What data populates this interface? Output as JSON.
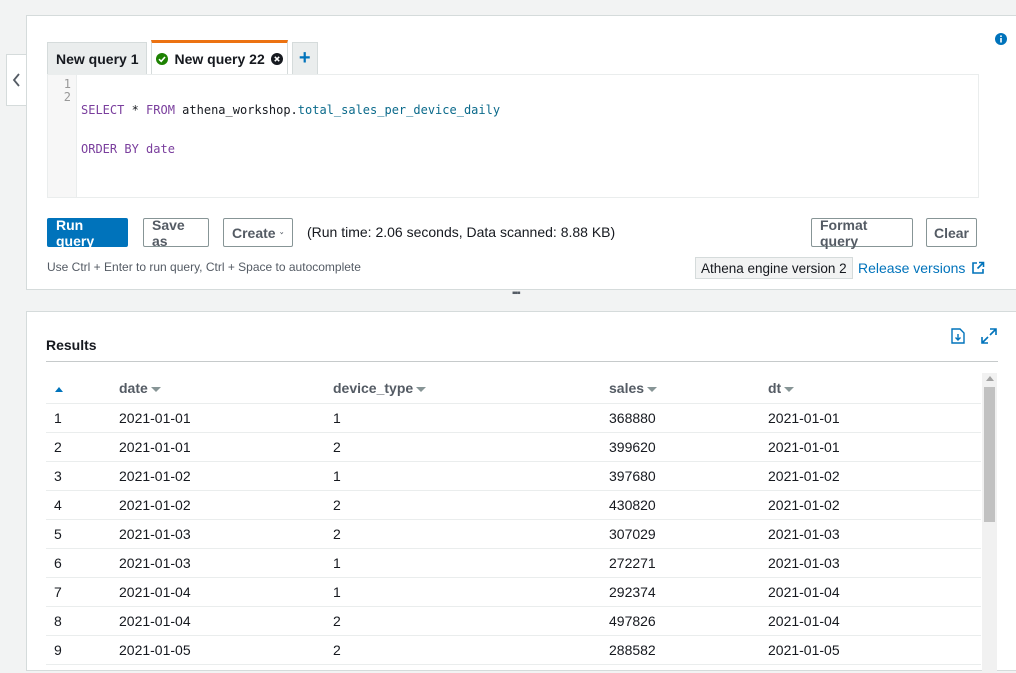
{
  "editor": {
    "tabs": [
      {
        "label": "New query 1",
        "active": false
      },
      {
        "label": "New query 22",
        "active": true,
        "status": "succeeded"
      }
    ],
    "add_tab_label": "+",
    "lines": [
      {
        "num": "1",
        "tokens": [
          {
            "text": "SELECT",
            "cls": "kw"
          },
          {
            "text": " * ",
            "cls": "id"
          },
          {
            "text": "FROM",
            "cls": "kw"
          },
          {
            "text": " athena_workshop.",
            "cls": "id"
          },
          {
            "text": "total_sales_per_device_daily",
            "cls": "tbl"
          }
        ]
      },
      {
        "num": "2",
        "tokens": [
          {
            "text": "ORDER BY",
            "cls": "kw"
          },
          {
            "text": " ",
            "cls": "id"
          },
          {
            "text": "date",
            "cls": "kw"
          }
        ]
      }
    ]
  },
  "toolbar": {
    "run_label": "Run query",
    "save_label": "Save as",
    "create_label": "Create",
    "run_info": "(Run time: 2.06 seconds, Data scanned: 8.88 KB)",
    "format_label": "Format query",
    "clear_label": "Clear"
  },
  "hint": "Use Ctrl + Enter to run query, Ctrl + Space to autocomplete",
  "engine_version": "Athena engine version 2",
  "release_versions": "Release versions",
  "results": {
    "title": "Results",
    "columns": [
      "date",
      "device_type",
      "sales",
      "dt"
    ],
    "rows": [
      [
        "1",
        "2021-01-01",
        "1",
        "368880",
        "2021-01-01"
      ],
      [
        "2",
        "2021-01-01",
        "2",
        "399620",
        "2021-01-01"
      ],
      [
        "3",
        "2021-01-02",
        "1",
        "397680",
        "2021-01-02"
      ],
      [
        "4",
        "2021-01-02",
        "2",
        "430820",
        "2021-01-02"
      ],
      [
        "5",
        "2021-01-03",
        "2",
        "307029",
        "2021-01-03"
      ],
      [
        "6",
        "2021-01-03",
        "1",
        "272271",
        "2021-01-03"
      ],
      [
        "7",
        "2021-01-04",
        "1",
        "292374",
        "2021-01-04"
      ],
      [
        "8",
        "2021-01-04",
        "2",
        "497826",
        "2021-01-04"
      ],
      [
        "9",
        "2021-01-05",
        "2",
        "288582",
        "2021-01-05"
      ]
    ]
  },
  "colors": {
    "accent": "#0073bb",
    "active_tab": "#ec7211",
    "success": "#1d8102"
  }
}
